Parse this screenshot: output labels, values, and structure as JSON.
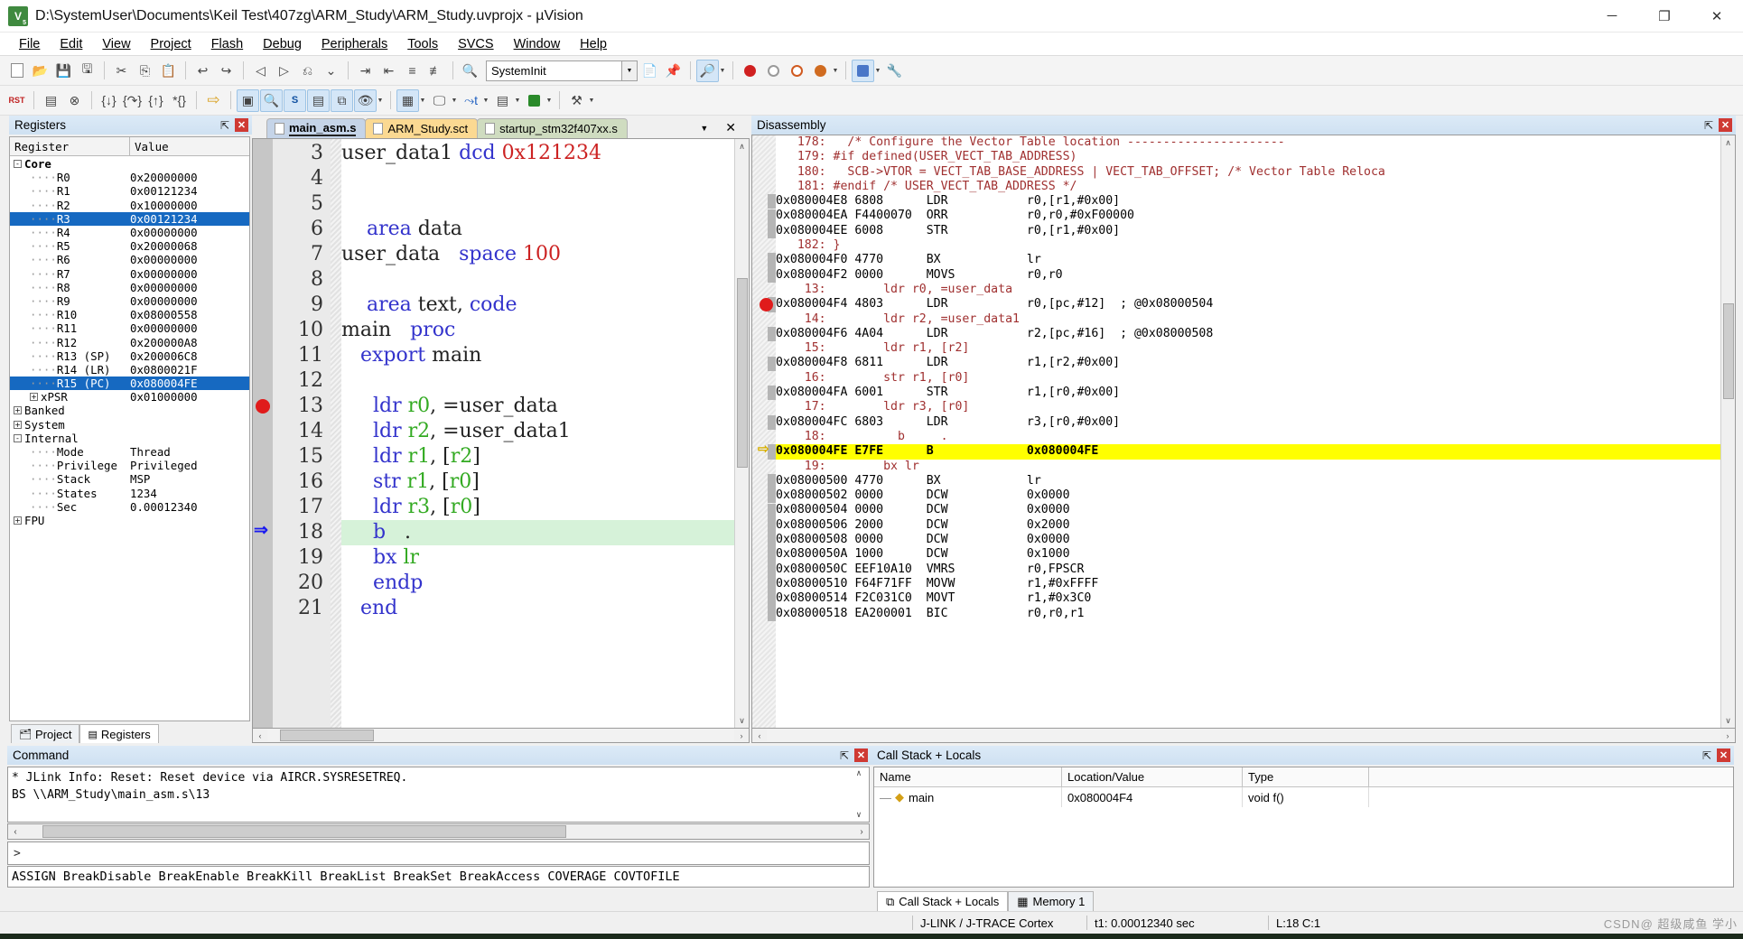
{
  "window": {
    "title": "D:\\SystemUser\\Documents\\Keil Test\\407zg\\ARM_Study\\ARM_Study.uvprojx - µVision",
    "app_icon_label": "V",
    "app_icon_sub": "5",
    "minimize": "─",
    "maximize": "❐",
    "close": "✕"
  },
  "menu": [
    {
      "label": "File"
    },
    {
      "label": "Edit"
    },
    {
      "label": "View"
    },
    {
      "label": "Project"
    },
    {
      "label": "Flash"
    },
    {
      "label": "Debug"
    },
    {
      "label": "Peripherals"
    },
    {
      "label": "Tools"
    },
    {
      "label": "SVCS"
    },
    {
      "label": "Window"
    },
    {
      "label": "Help"
    }
  ],
  "toolbar2": {
    "target_combo_value": "SystemInit",
    "target_combo_placeholder": "SystemInit"
  },
  "registers": {
    "panel_title": "Registers",
    "columns": [
      "Register",
      "Value"
    ],
    "rows": [
      {
        "indent": 0,
        "toggle": "-",
        "name": "Core",
        "value": "",
        "bold": true,
        "selected": false
      },
      {
        "indent": 1,
        "toggle": "",
        "name": "R0",
        "value": "0x20000000",
        "bold": false,
        "selected": false
      },
      {
        "indent": 1,
        "toggle": "",
        "name": "R1",
        "value": "0x00121234",
        "bold": false,
        "selected": false
      },
      {
        "indent": 1,
        "toggle": "",
        "name": "R2",
        "value": "0x10000000",
        "bold": false,
        "selected": false
      },
      {
        "indent": 1,
        "toggle": "",
        "name": "R3",
        "value": "0x00121234",
        "bold": false,
        "selected": true
      },
      {
        "indent": 1,
        "toggle": "",
        "name": "R4",
        "value": "0x00000000",
        "bold": false,
        "selected": false
      },
      {
        "indent": 1,
        "toggle": "",
        "name": "R5",
        "value": "0x20000068",
        "bold": false,
        "selected": false
      },
      {
        "indent": 1,
        "toggle": "",
        "name": "R6",
        "value": "0x00000000",
        "bold": false,
        "selected": false
      },
      {
        "indent": 1,
        "toggle": "",
        "name": "R7",
        "value": "0x00000000",
        "bold": false,
        "selected": false
      },
      {
        "indent": 1,
        "toggle": "",
        "name": "R8",
        "value": "0x00000000",
        "bold": false,
        "selected": false
      },
      {
        "indent": 1,
        "toggle": "",
        "name": "R9",
        "value": "0x00000000",
        "bold": false,
        "selected": false
      },
      {
        "indent": 1,
        "toggle": "",
        "name": "R10",
        "value": "0x08000558",
        "bold": false,
        "selected": false
      },
      {
        "indent": 1,
        "toggle": "",
        "name": "R11",
        "value": "0x00000000",
        "bold": false,
        "selected": false
      },
      {
        "indent": 1,
        "toggle": "",
        "name": "R12",
        "value": "0x200000A8",
        "bold": false,
        "selected": false
      },
      {
        "indent": 1,
        "toggle": "",
        "name": "R13 (SP)",
        "value": "0x200006C8",
        "bold": false,
        "selected": false
      },
      {
        "indent": 1,
        "toggle": "",
        "name": "R14 (LR)",
        "value": "0x0800021F",
        "bold": false,
        "selected": false
      },
      {
        "indent": 1,
        "toggle": "",
        "name": "R15 (PC)",
        "value": "0x080004FE",
        "bold": false,
        "selected": true
      },
      {
        "indent": 1,
        "toggle": "+",
        "name": "xPSR",
        "value": "0x01000000",
        "bold": false,
        "selected": false
      },
      {
        "indent": 0,
        "toggle": "+",
        "name": "Banked",
        "value": "",
        "bold": false,
        "selected": false
      },
      {
        "indent": 0,
        "toggle": "+",
        "name": "System",
        "value": "",
        "bold": false,
        "selected": false
      },
      {
        "indent": 0,
        "toggle": "-",
        "name": "Internal",
        "value": "",
        "bold": false,
        "selected": false
      },
      {
        "indent": 1,
        "toggle": "",
        "name": "Mode",
        "value": "Thread",
        "bold": false,
        "selected": false
      },
      {
        "indent": 1,
        "toggle": "",
        "name": "Privilege",
        "value": "Privileged",
        "bold": false,
        "selected": false
      },
      {
        "indent": 1,
        "toggle": "",
        "name": "Stack",
        "value": "MSP",
        "bold": false,
        "selected": false
      },
      {
        "indent": 1,
        "toggle": "",
        "name": "States",
        "value": "1234",
        "bold": false,
        "selected": false
      },
      {
        "indent": 1,
        "toggle": "",
        "name": "Sec",
        "value": "0.00012340",
        "bold": false,
        "selected": false
      },
      {
        "indent": 0,
        "toggle": "+",
        "name": "FPU",
        "value": "",
        "bold": false,
        "selected": false
      }
    ],
    "tabs": [
      {
        "label": "Project",
        "active": false,
        "icon": "project-icon"
      },
      {
        "label": "Registers",
        "active": true,
        "icon": "registers-icon"
      }
    ]
  },
  "editor": {
    "tabs": [
      {
        "label": "main_asm.s",
        "active": true
      },
      {
        "label": "ARM_Study.sct",
        "active": false
      },
      {
        "label": "startup_stm32f407xx.s",
        "active": false
      }
    ],
    "lines": [
      {
        "num": "3",
        "tokens": [
          {
            "t": "user_data1 ",
            "c": "p"
          },
          {
            "t": "dcd",
            "c": "k"
          },
          {
            "t": " ",
            "c": "p"
          },
          {
            "t": "0x121234",
            "c": "n"
          }
        ],
        "highlight": false,
        "breakpoint": false,
        "pc": false
      },
      {
        "num": "4",
        "tokens": [],
        "highlight": false,
        "breakpoint": false,
        "pc": false
      },
      {
        "num": "5",
        "tokens": [],
        "highlight": false,
        "breakpoint": false,
        "pc": false
      },
      {
        "num": "6",
        "tokens": [
          {
            "t": "    ",
            "c": "p"
          },
          {
            "t": "area",
            "c": "k"
          },
          {
            "t": " data",
            "c": "p"
          }
        ],
        "highlight": false,
        "breakpoint": false,
        "pc": false
      },
      {
        "num": "7",
        "tokens": [
          {
            "t": "user_data   ",
            "c": "p"
          },
          {
            "t": "space",
            "c": "k"
          },
          {
            "t": " ",
            "c": "p"
          },
          {
            "t": "100",
            "c": "n"
          }
        ],
        "highlight": false,
        "breakpoint": false,
        "pc": false
      },
      {
        "num": "8",
        "tokens": [],
        "highlight": false,
        "breakpoint": false,
        "pc": false
      },
      {
        "num": "9",
        "tokens": [
          {
            "t": "    ",
            "c": "p"
          },
          {
            "t": "area",
            "c": "k"
          },
          {
            "t": " text, ",
            "c": "p"
          },
          {
            "t": "code",
            "c": "k"
          }
        ],
        "highlight": false,
        "breakpoint": false,
        "pc": false
      },
      {
        "num": "10",
        "tokens": [
          {
            "t": "main   ",
            "c": "p"
          },
          {
            "t": "proc",
            "c": "k"
          }
        ],
        "highlight": false,
        "breakpoint": false,
        "pc": false
      },
      {
        "num": "11",
        "tokens": [
          {
            "t": "   ",
            "c": "p"
          },
          {
            "t": "export",
            "c": "k"
          },
          {
            "t": " main",
            "c": "p"
          }
        ],
        "highlight": false,
        "breakpoint": false,
        "pc": false
      },
      {
        "num": "12",
        "tokens": [],
        "highlight": false,
        "breakpoint": false,
        "pc": false
      },
      {
        "num": "13",
        "tokens": [
          {
            "t": "     ",
            "c": "p"
          },
          {
            "t": "ldr",
            "c": "k"
          },
          {
            "t": " ",
            "c": "p"
          },
          {
            "t": "r0",
            "c": "g"
          },
          {
            "t": ", =user_data",
            "c": "p"
          }
        ],
        "highlight": false,
        "breakpoint": true,
        "pc": false
      },
      {
        "num": "14",
        "tokens": [
          {
            "t": "     ",
            "c": "p"
          },
          {
            "t": "ldr",
            "c": "k"
          },
          {
            "t": " ",
            "c": "p"
          },
          {
            "t": "r2",
            "c": "g"
          },
          {
            "t": ", =user_data1",
            "c": "p"
          }
        ],
        "highlight": false,
        "breakpoint": false,
        "pc": false
      },
      {
        "num": "15",
        "tokens": [
          {
            "t": "     ",
            "c": "p"
          },
          {
            "t": "ldr",
            "c": "k"
          },
          {
            "t": " ",
            "c": "p"
          },
          {
            "t": "r1",
            "c": "g"
          },
          {
            "t": ", [",
            "c": "p"
          },
          {
            "t": "r2",
            "c": "g"
          },
          {
            "t": "]",
            "c": "p"
          }
        ],
        "highlight": false,
        "breakpoint": false,
        "pc": false
      },
      {
        "num": "16",
        "tokens": [
          {
            "t": "     ",
            "c": "p"
          },
          {
            "t": "str",
            "c": "k"
          },
          {
            "t": " ",
            "c": "p"
          },
          {
            "t": "r1",
            "c": "g"
          },
          {
            "t": ", [",
            "c": "p"
          },
          {
            "t": "r0",
            "c": "g"
          },
          {
            "t": "]",
            "c": "p"
          }
        ],
        "highlight": false,
        "breakpoint": false,
        "pc": false
      },
      {
        "num": "17",
        "tokens": [
          {
            "t": "     ",
            "c": "p"
          },
          {
            "t": "ldr",
            "c": "k"
          },
          {
            "t": " ",
            "c": "p"
          },
          {
            "t": "r3",
            "c": "g"
          },
          {
            "t": ", [",
            "c": "p"
          },
          {
            "t": "r0",
            "c": "g"
          },
          {
            "t": "]",
            "c": "p"
          }
        ],
        "highlight": false,
        "breakpoint": false,
        "pc": false
      },
      {
        "num": "18",
        "tokens": [
          {
            "t": "     ",
            "c": "p"
          },
          {
            "t": "b",
            "c": "k"
          },
          {
            "t": "   .",
            "c": "p"
          }
        ],
        "highlight": true,
        "breakpoint": false,
        "pc": true
      },
      {
        "num": "19",
        "tokens": [
          {
            "t": "     ",
            "c": "p"
          },
          {
            "t": "bx",
            "c": "k"
          },
          {
            "t": " ",
            "c": "p"
          },
          {
            "t": "lr",
            "c": "g"
          }
        ],
        "highlight": false,
        "breakpoint": false,
        "pc": false
      },
      {
        "num": "20",
        "tokens": [
          {
            "t": "     ",
            "c": "p"
          },
          {
            "t": "endp",
            "c": "k"
          }
        ],
        "highlight": false,
        "breakpoint": false,
        "pc": false
      },
      {
        "num": "21",
        "tokens": [
          {
            "t": "   ",
            "c": "p"
          },
          {
            "t": "end",
            "c": "k"
          }
        ],
        "highlight": false,
        "breakpoint": false,
        "pc": false
      }
    ]
  },
  "disassembly": {
    "panel_title": "Disassembly",
    "lines": [
      {
        "kind": "src",
        "text": "   178:   /* Configure the Vector Table location ----------------------",
        "current": false,
        "breakpoint": false
      },
      {
        "kind": "src",
        "text": "   179: #if defined(USER_VECT_TAB_ADDRESS)",
        "current": false,
        "breakpoint": false
      },
      {
        "kind": "src",
        "text": "   180:   SCB->VTOR = VECT_TAB_BASE_ADDRESS | VECT_TAB_OFFSET; /* Vector Table Reloca",
        "current": false,
        "breakpoint": false
      },
      {
        "kind": "src",
        "text": "   181: #endif /* USER_VECT_TAB_ADDRESS */",
        "current": false,
        "breakpoint": false
      },
      {
        "kind": "asm",
        "text": "0x080004E8 6808      LDR           r0,[r1,#0x00]",
        "current": false,
        "breakpoint": false
      },
      {
        "kind": "asm",
        "text": "0x080004EA F4400070  ORR           r0,r0,#0xF00000",
        "current": false,
        "breakpoint": false
      },
      {
        "kind": "asm",
        "text": "0x080004EE 6008      STR           r0,[r1,#0x00]",
        "current": false,
        "breakpoint": false
      },
      {
        "kind": "src",
        "text": "   182: }",
        "current": false,
        "breakpoint": false
      },
      {
        "kind": "asm",
        "text": "0x080004F0 4770      BX            lr",
        "current": false,
        "breakpoint": false
      },
      {
        "kind": "asm",
        "text": "0x080004F2 0000      MOVS          r0,r0",
        "current": false,
        "breakpoint": false
      },
      {
        "kind": "src",
        "text": "    13:        ldr r0, =user_data",
        "current": false,
        "breakpoint": false
      },
      {
        "kind": "asm",
        "text": "0x080004F4 4803      LDR           r0,[pc,#12]  ; @0x08000504",
        "current": false,
        "breakpoint": true
      },
      {
        "kind": "src",
        "text": "    14:        ldr r2, =user_data1",
        "current": false,
        "breakpoint": false
      },
      {
        "kind": "asm",
        "text": "0x080004F6 4A04      LDR           r2,[pc,#16]  ; @0x08000508",
        "current": false,
        "breakpoint": false
      },
      {
        "kind": "src",
        "text": "    15:        ldr r1, [r2]",
        "current": false,
        "breakpoint": false
      },
      {
        "kind": "asm",
        "text": "0x080004F8 6811      LDR           r1,[r2,#0x00]",
        "current": false,
        "breakpoint": false
      },
      {
        "kind": "src",
        "text": "    16:        str r1, [r0]",
        "current": false,
        "breakpoint": false
      },
      {
        "kind": "asm",
        "text": "0x080004FA 6001      STR           r1,[r0,#0x00]",
        "current": false,
        "breakpoint": false
      },
      {
        "kind": "src",
        "text": "    17:        ldr r3, [r0]",
        "current": false,
        "breakpoint": false
      },
      {
        "kind": "asm",
        "text": "0x080004FC 6803      LDR           r3,[r0,#0x00]",
        "current": false,
        "breakpoint": false
      },
      {
        "kind": "src",
        "text": "    18:          b     .",
        "current": false,
        "breakpoint": false
      },
      {
        "kind": "asm",
        "text": "0x080004FE E7FE      B             0x080004FE",
        "current": true,
        "breakpoint": false
      },
      {
        "kind": "src",
        "text": "    19:        bx lr",
        "current": false,
        "breakpoint": false
      },
      {
        "kind": "asm",
        "text": "0x08000500 4770      BX            lr",
        "current": false,
        "breakpoint": false
      },
      {
        "kind": "asm",
        "text": "0x08000502 0000      DCW           0x0000",
        "current": false,
        "breakpoint": false
      },
      {
        "kind": "asm",
        "text": "0x08000504 0000      DCW           0x0000",
        "current": false,
        "breakpoint": false
      },
      {
        "kind": "asm",
        "text": "0x08000506 2000      DCW           0x2000",
        "current": false,
        "breakpoint": false
      },
      {
        "kind": "asm",
        "text": "0x08000508 0000      DCW           0x0000",
        "current": false,
        "breakpoint": false
      },
      {
        "kind": "asm",
        "text": "0x0800050A 1000      DCW           0x1000",
        "current": false,
        "breakpoint": false
      },
      {
        "kind": "asm",
        "text": "0x0800050C EEF10A10  VMRS          r0,FPSCR",
        "current": false,
        "breakpoint": false
      },
      {
        "kind": "asm",
        "text": "0x08000510 F64F71FF  MOVW          r1,#0xFFFF",
        "current": false,
        "breakpoint": false
      },
      {
        "kind": "asm",
        "text": "0x08000514 F2C031C0  MOVT          r1,#0x3C0",
        "current": false,
        "breakpoint": false
      },
      {
        "kind": "asm",
        "text": "0x08000518 EA200001  BIC           r0,r0,r1",
        "current": false,
        "breakpoint": false
      }
    ]
  },
  "command": {
    "panel_title": "Command",
    "output_lines": [
      "* JLink Info: Reset: Reset device via AIRCR.SYSRESETREQ.",
      "BS \\\\ARM_Study\\main_asm.s\\13"
    ],
    "prompt": ">",
    "input_value": "",
    "hint_line": "ASSIGN BreakDisable BreakEnable BreakKill BreakList BreakSet BreakAccess COVERAGE COVTOFILE"
  },
  "callstack": {
    "panel_title": "Call Stack + Locals",
    "columns": [
      "Name",
      "Location/Value",
      "Type"
    ],
    "rows": [
      {
        "name": "main",
        "location": "0x080004F4",
        "type": "void f()"
      }
    ],
    "tabs": [
      {
        "label": "Call Stack + Locals",
        "active": true
      },
      {
        "label": "Memory 1",
        "active": false
      }
    ]
  },
  "statusbar": {
    "debugger": "J-LINK / J-TRACE Cortex",
    "time": "t1: 0.00012340 sec",
    "position": "L:18 C:1",
    "watermark": "CSDN@ 超级咸鱼 学小"
  }
}
